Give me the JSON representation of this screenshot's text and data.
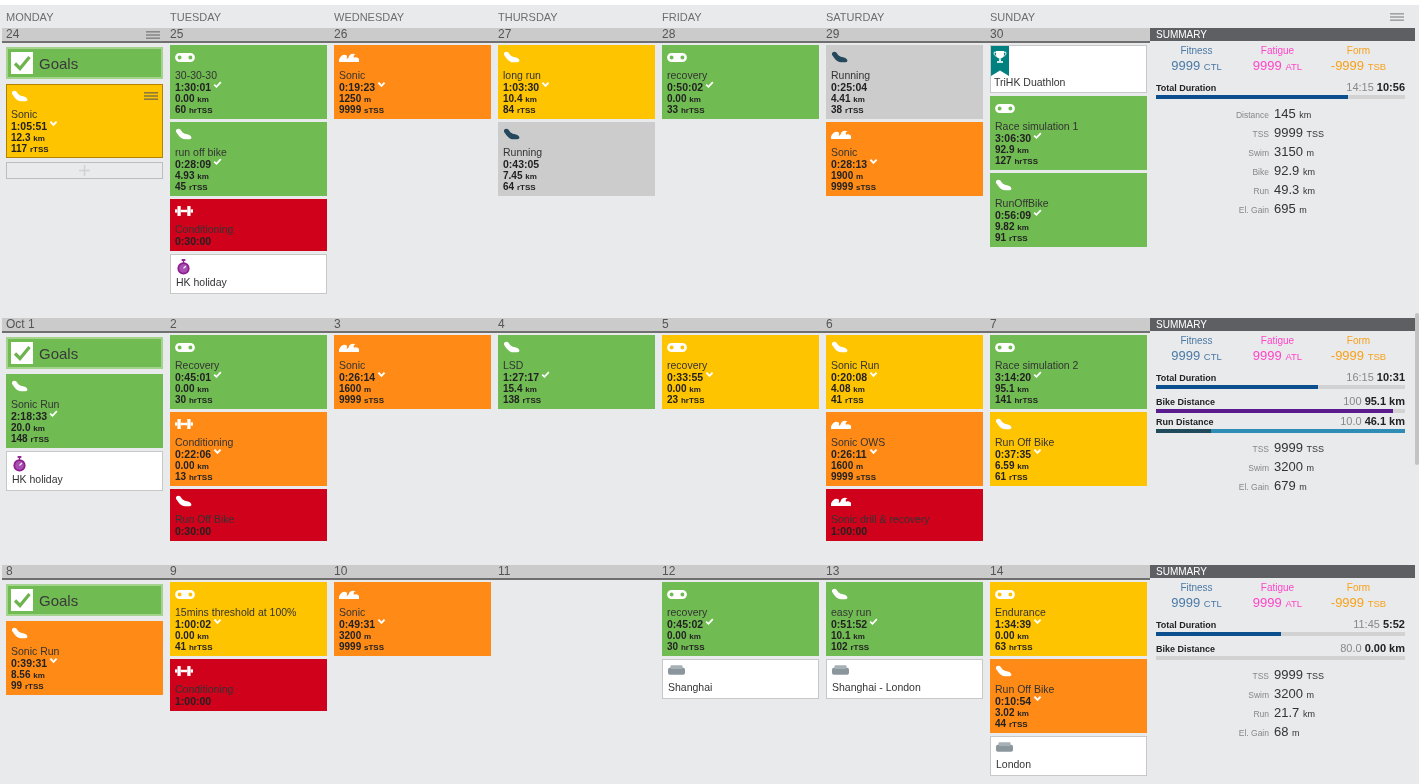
{
  "day_names": [
    "MONDAY",
    "TUESDAY",
    "WEDNESDAY",
    "THURSDAY",
    "FRIDAY",
    "SATURDAY",
    "SUNDAY"
  ],
  "weeks": [
    {
      "days": [
        {
          "date": "24",
          "selected": true,
          "items": [
            {
              "kind": "goals",
              "title": "Goals"
            },
            {
              "kind": "run",
              "title": "Sonic",
              "duration": "1:05:51",
              "completed": false,
              "partial": true,
              "planned": true,
              "distance": {
                "value": "12.3",
                "unit": "km"
              },
              "tss": {
                "value": "117",
                "unit": "rTSS"
              },
              "color": "#ffc400",
              "selected": true
            }
          ]
        },
        {
          "date": "25",
          "selected": false,
          "items": [
            {
              "kind": "bike",
              "title": "30-30-30",
              "duration": "1:30:01",
              "completed": true,
              "partial": false,
              "planned": true,
              "distance": {
                "value": "0.00",
                "unit": "km"
              },
              "tss": {
                "value": "60",
                "unit": "hrTSS"
              },
              "color": "#71bb53",
              "selected": false
            },
            {
              "kind": "run",
              "title": "run off bike",
              "duration": "0:28:09",
              "completed": true,
              "partial": false,
              "planned": true,
              "distance": {
                "value": "4.93",
                "unit": "km"
              },
              "tss": {
                "value": "45",
                "unit": "rTSS"
              },
              "color": "#71bb53",
              "selected": false
            },
            {
              "kind": "strength",
              "title": "Conditioning",
              "duration": "0:30:00",
              "completed": false,
              "partial": false,
              "planned": true,
              "color": "#d0021b",
              "selected": false
            },
            {
              "kind": "note",
              "title": "HK holiday"
            }
          ]
        },
        {
          "date": "26",
          "selected": false,
          "items": [
            {
              "kind": "swim",
              "title": "Sonic",
              "duration": "0:19:23",
              "completed": false,
              "partial": true,
              "planned": true,
              "distance": {
                "value": "1250",
                "unit": "m"
              },
              "tss": {
                "value": "9999",
                "unit": "sTSS"
              },
              "color": "#ff8b16",
              "selected": false
            }
          ]
        },
        {
          "date": "27",
          "selected": false,
          "items": [
            {
              "kind": "run",
              "title": "long run",
              "duration": "1:03:30",
              "completed": false,
              "partial": true,
              "planned": true,
              "distance": {
                "value": "10.4",
                "unit": "km"
              },
              "tss": {
                "value": "84",
                "unit": "rTSS"
              },
              "color": "#ffc400",
              "selected": false
            },
            {
              "kind": "run",
              "title": "Running",
              "duration": "0:43:05",
              "completed": false,
              "partial": false,
              "planned": false,
              "distance": {
                "value": "7.45",
                "unit": "km"
              },
              "tss": {
                "value": "64",
                "unit": "rTSS"
              },
              "color": "#cccccc",
              "selected": false
            }
          ]
        },
        {
          "date": "28",
          "selected": false,
          "items": [
            {
              "kind": "bike",
              "title": "recovery",
              "duration": "0:50:02",
              "completed": true,
              "partial": false,
              "planned": true,
              "distance": {
                "value": "0.00",
                "unit": "km"
              },
              "tss": {
                "value": "33",
                "unit": "hrTSS"
              },
              "color": "#71bb53",
              "selected": false
            }
          ]
        },
        {
          "date": "29",
          "selected": false,
          "items": [
            {
              "kind": "run",
              "title": "Running",
              "duration": "0:25:04",
              "completed": false,
              "partial": false,
              "planned": false,
              "distance": {
                "value": "4.41",
                "unit": "km"
              },
              "tss": {
                "value": "38",
                "unit": "rTSS"
              },
              "color": "#cccccc",
              "selected": false
            },
            {
              "kind": "swim",
              "title": "Sonic",
              "duration": "0:28:13",
              "completed": false,
              "partial": true,
              "planned": true,
              "distance": {
                "value": "1900",
                "unit": "m"
              },
              "tss": {
                "value": "9999",
                "unit": "sTSS"
              },
              "color": "#ff8b16",
              "selected": false
            }
          ]
        },
        {
          "date": "30",
          "selected": false,
          "items": [
            {
              "kind": "race",
              "title": "TriHK Duathlon"
            },
            {
              "kind": "bike",
              "title": "Race simulation 1",
              "duration": "3:06:30",
              "completed": true,
              "partial": false,
              "planned": true,
              "distance": {
                "value": "92.9",
                "unit": "km"
              },
              "tss": {
                "value": "127",
                "unit": "hrTSS"
              },
              "color": "#71bb53",
              "selected": false
            },
            {
              "kind": "run",
              "title": "RunOffBike",
              "duration": "0:56:09",
              "completed": true,
              "partial": false,
              "planned": true,
              "distance": {
                "value": "9.82",
                "unit": "km"
              },
              "tss": {
                "value": "91",
                "unit": "rTSS"
              },
              "color": "#71bb53",
              "selected": false
            }
          ]
        }
      ],
      "summary": {
        "title": "SUMMARY",
        "metrics": [
          {
            "label": "Fitness",
            "value": "9999",
            "unit": "CTL",
            "color": "#4b7aa5"
          },
          {
            "label": "Fatigue",
            "value": "9999",
            "unit": "ATL",
            "color": "#ff45c8"
          },
          {
            "label": "Form",
            "value": "-9999",
            "unit": "TSB",
            "color": "#f7a21d"
          }
        ],
        "bars": [
          {
            "label": "Total Duration",
            "planned": "14:15",
            "actual": "10:56",
            "level": 0.77,
            "color": "#0b4f8e",
            "exceeded": false
          }
        ],
        "stats": [
          {
            "label": "Distance",
            "value": "145",
            "unit": "km"
          },
          {
            "label": "TSS",
            "value": "9999",
            "unit": "TSS"
          },
          {
            "label": "Swim",
            "value": "3150",
            "unit": "m"
          },
          {
            "label": "Bike",
            "value": "92.9",
            "unit": "km"
          },
          {
            "label": "Run",
            "value": "49.3",
            "unit": "km"
          },
          {
            "label": "El. Gain",
            "value": "695",
            "unit": "m"
          }
        ]
      }
    },
    {
      "days": [
        {
          "date": "Oct 1",
          "selected": false,
          "items": [
            {
              "kind": "goals",
              "title": "Goals"
            },
            {
              "kind": "run",
              "title": "Sonic Run",
              "duration": "2:18:33",
              "completed": true,
              "partial": false,
              "planned": true,
              "distance": {
                "value": "20.0",
                "unit": "km"
              },
              "tss": {
                "value": "148",
                "unit": "rTSS"
              },
              "color": "#71bb53",
              "selected": false
            },
            {
              "kind": "note",
              "title": "HK holiday"
            }
          ]
        },
        {
          "date": "2",
          "selected": false,
          "items": [
            {
              "kind": "bike",
              "title": "Recovery",
              "duration": "0:45:01",
              "completed": true,
              "partial": false,
              "planned": true,
              "distance": {
                "value": "0.00",
                "unit": "km"
              },
              "tss": {
                "value": "30",
                "unit": "hrTSS"
              },
              "color": "#71bb53",
              "selected": false
            },
            {
              "kind": "strength",
              "title": "Conditioning",
              "duration": "0:22:06",
              "completed": false,
              "partial": true,
              "planned": true,
              "distance": {
                "value": "0.00",
                "unit": "km"
              },
              "tss": {
                "value": "13",
                "unit": "hrTSS"
              },
              "color": "#ff8b16",
              "selected": false
            },
            {
              "kind": "run",
              "title": "Run Off Bike",
              "duration": "0:30:00",
              "completed": false,
              "partial": false,
              "planned": true,
              "color": "#d0021b",
              "selected": false
            }
          ]
        },
        {
          "date": "3",
          "selected": false,
          "items": [
            {
              "kind": "swim",
              "title": "Sonic",
              "duration": "0:26:14",
              "completed": false,
              "partial": true,
              "planned": true,
              "distance": {
                "value": "1600",
                "unit": "m"
              },
              "tss": {
                "value": "9999",
                "unit": "sTSS"
              },
              "color": "#ff8b16",
              "selected": false
            }
          ]
        },
        {
          "date": "4",
          "selected": false,
          "items": [
            {
              "kind": "run",
              "title": "LSD",
              "duration": "1:27:17",
              "completed": true,
              "partial": false,
              "planned": true,
              "distance": {
                "value": "15.4",
                "unit": "km"
              },
              "tss": {
                "value": "138",
                "unit": "rTSS"
              },
              "color": "#71bb53",
              "selected": false
            }
          ]
        },
        {
          "date": "5",
          "selected": false,
          "items": [
            {
              "kind": "bike",
              "title": "recovery",
              "duration": "0:33:55",
              "completed": false,
              "partial": true,
              "planned": true,
              "distance": {
                "value": "0.00",
                "unit": "km"
              },
              "tss": {
                "value": "23",
                "unit": "hrTSS"
              },
              "color": "#ffc400",
              "selected": false
            }
          ]
        },
        {
          "date": "6",
          "selected": false,
          "items": [
            {
              "kind": "run",
              "title": "Sonic Run",
              "duration": "0:20:08",
              "completed": false,
              "partial": true,
              "planned": true,
              "distance": {
                "value": "4.08",
                "unit": "km"
              },
              "tss": {
                "value": "41",
                "unit": "rTSS"
              },
              "color": "#ffc400",
              "selected": false
            },
            {
              "kind": "swim",
              "title": "Sonic OWS",
              "duration": "0:26:11",
              "completed": false,
              "partial": true,
              "planned": true,
              "distance": {
                "value": "1600",
                "unit": "m"
              },
              "tss": {
                "value": "9999",
                "unit": "sTSS"
              },
              "color": "#ff8b16",
              "selected": false
            },
            {
              "kind": "swim",
              "title": "Sonic drill & recovery",
              "duration": "1:00:00",
              "completed": false,
              "partial": false,
              "planned": true,
              "color": "#d0021b",
              "selected": false
            }
          ]
        },
        {
          "date": "7",
          "selected": false,
          "items": [
            {
              "kind": "bike",
              "title": "Race simulation 2",
              "duration": "3:14:20",
              "completed": true,
              "partial": false,
              "planned": true,
              "distance": {
                "value": "95.1",
                "unit": "km"
              },
              "tss": {
                "value": "141",
                "unit": "hrTSS"
              },
              "color": "#71bb53",
              "selected": false
            },
            {
              "kind": "run",
              "title": "Run Off Bike",
              "duration": "0:37:35",
              "completed": false,
              "partial": true,
              "planned": true,
              "distance": {
                "value": "6.59",
                "unit": "km"
              },
              "tss": {
                "value": "61",
                "unit": "rTSS"
              },
              "color": "#ffc400",
              "selected": false
            }
          ]
        }
      ],
      "summary": {
        "title": "SUMMARY",
        "metrics": [
          {
            "label": "Fitness",
            "value": "9999",
            "unit": "CTL",
            "color": "#4b7aa5"
          },
          {
            "label": "Fatigue",
            "value": "9999",
            "unit": "ATL",
            "color": "#ff45c8"
          },
          {
            "label": "Form",
            "value": "-9999",
            "unit": "TSB",
            "color": "#f7a21d"
          }
        ],
        "bars": [
          {
            "label": "Total Duration",
            "planned": "16:15",
            "actual": "10:31",
            "level": 0.65,
            "color": "#0b4f8e",
            "exceeded": false
          },
          {
            "label": "Bike Distance",
            "planned": "100",
            "actual": "95.1 km",
            "level": 0.95,
            "color": "#5a1c8c",
            "exceeded": false
          },
          {
            "label": "Run Distance",
            "planned": "10.0",
            "actual": "46.1 km",
            "level": 0.22,
            "color": "#1e4a5c",
            "exceeded": true
          }
        ],
        "stats": [
          {
            "label": "TSS",
            "value": "9999",
            "unit": "TSS"
          },
          {
            "label": "Swim",
            "value": "3200",
            "unit": "m"
          },
          {
            "label": "El. Gain",
            "value": "679",
            "unit": "m"
          }
        ]
      }
    },
    {
      "days": [
        {
          "date": "8",
          "selected": false,
          "items": [
            {
              "kind": "goals",
              "title": "Goals"
            },
            {
              "kind": "run",
              "title": "Sonic Run",
              "duration": "0:39:31",
              "completed": false,
              "partial": true,
              "planned": true,
              "distance": {
                "value": "8.56",
                "unit": "km"
              },
              "tss": {
                "value": "99",
                "unit": "rTSS"
              },
              "color": "#ff8b16",
              "selected": false
            }
          ]
        },
        {
          "date": "9",
          "selected": false,
          "items": [
            {
              "kind": "bike",
              "title": "15mins threshold at 100%",
              "duration": "1:00:02",
              "completed": false,
              "partial": true,
              "planned": true,
              "distance": {
                "value": "0.00",
                "unit": "km"
              },
              "tss": {
                "value": "41",
                "unit": "hrTSS"
              },
              "color": "#ffc400",
              "selected": false
            },
            {
              "kind": "strength",
              "title": "Conditioning",
              "duration": "1:00:00",
              "completed": false,
              "partial": false,
              "planned": true,
              "color": "#d0021b",
              "selected": false
            }
          ]
        },
        {
          "date": "10",
          "selected": false,
          "items": [
            {
              "kind": "swim",
              "title": "Sonic",
              "duration": "0:49:31",
              "completed": false,
              "partial": true,
              "planned": true,
              "distance": {
                "value": "3200",
                "unit": "m"
              },
              "tss": {
                "value": "9999",
                "unit": "sTSS"
              },
              "color": "#ff8b16",
              "selected": false
            }
          ]
        },
        {
          "date": "11",
          "selected": false
        },
        {
          "date": "12",
          "selected": false,
          "items": [
            {
              "kind": "bike",
              "title": "recovery",
              "duration": "0:45:02",
              "completed": true,
              "partial": false,
              "planned": true,
              "distance": {
                "value": "0.00",
                "unit": "km"
              },
              "tss": {
                "value": "30",
                "unit": "hrTSS"
              },
              "color": "#71bb53",
              "selected": false
            },
            {
              "kind": "travel",
              "title": "Shanghai"
            }
          ]
        },
        {
          "date": "13",
          "selected": false,
          "items": [
            {
              "kind": "run",
              "title": "easy run",
              "duration": "0:51:52",
              "completed": true,
              "partial": false,
              "planned": true,
              "distance": {
                "value": "10.1",
                "unit": "km"
              },
              "tss": {
                "value": "102",
                "unit": "rTSS"
              },
              "color": "#71bb53",
              "selected": false
            },
            {
              "kind": "travel",
              "title": "Shanghai - London"
            }
          ]
        },
        {
          "date": "14",
          "selected": false,
          "items": [
            {
              "kind": "bike",
              "title": "Endurance",
              "duration": "1:34:39",
              "completed": false,
              "partial": true,
              "planned": true,
              "distance": {
                "value": "0.00",
                "unit": "km"
              },
              "tss": {
                "value": "63",
                "unit": "hrTSS"
              },
              "color": "#ffc400",
              "selected": false
            },
            {
              "kind": "run",
              "title": "Run Off Bike",
              "duration": "0:10:54",
              "completed": false,
              "partial": true,
              "planned": true,
              "distance": {
                "value": "3.02",
                "unit": "km"
              },
              "tss": {
                "value": "44",
                "unit": "rTSS"
              },
              "color": "#ff8b16",
              "selected": false
            },
            {
              "kind": "travel",
              "title": "London"
            }
          ]
        }
      ],
      "summary": {
        "title": "SUMMARY",
        "metrics": [
          {
            "label": "Fitness",
            "value": "9999",
            "unit": "CTL",
            "color": "#4b7aa5"
          },
          {
            "label": "Fatigue",
            "value": "9999",
            "unit": "ATL",
            "color": "#ff45c8"
          },
          {
            "label": "Form",
            "value": "-9999",
            "unit": "TSB",
            "color": "#f7a21d"
          }
        ],
        "bars": [
          {
            "label": "Total Duration",
            "planned": "11:45",
            "actual": "5:52",
            "level": 0.5,
            "color": "#0b4f8e",
            "exceeded": false
          },
          {
            "label": "Bike Distance",
            "planned": "80.0",
            "actual": "0.00 km",
            "exceeded": false
          }
        ],
        "stats": [
          {
            "label": "TSS",
            "value": "9999",
            "unit": "TSS"
          },
          {
            "label": "Swim",
            "value": "3200",
            "unit": "m"
          },
          {
            "label": "Run",
            "value": "21.7",
            "unit": "km"
          },
          {
            "label": "El. Gain",
            "value": "68",
            "unit": "m"
          }
        ]
      }
    }
  ]
}
